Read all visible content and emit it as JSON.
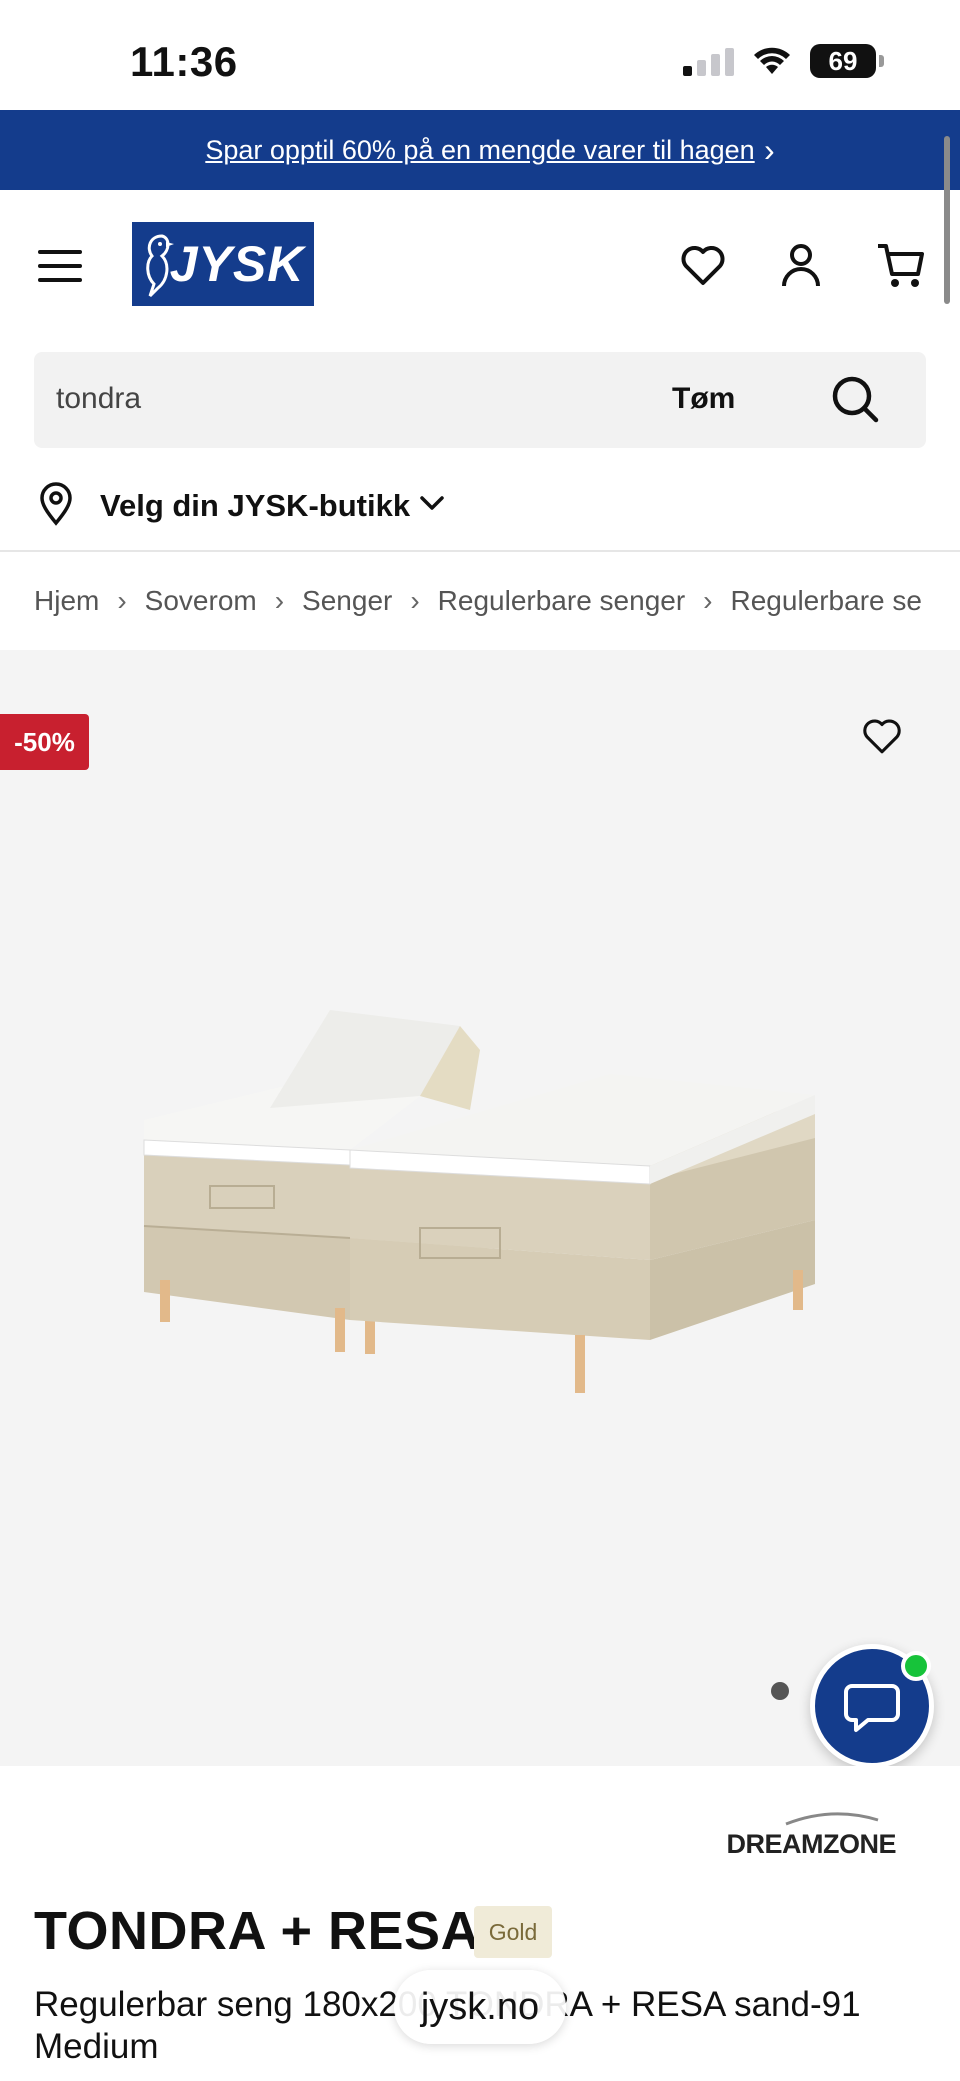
{
  "status_bar": {
    "time": "11:36",
    "battery": "69"
  },
  "promo": {
    "text": "Spar opptil 60% på en mengde varer til hagen",
    "chevron": "›"
  },
  "header": {
    "logo_text": "JYSK",
    "icons": [
      "menu-icon",
      "heart-icon",
      "user-icon",
      "cart-icon"
    ]
  },
  "search": {
    "value": "tondra",
    "clear_label": "Tøm"
  },
  "store": {
    "label": "Velg din JYSK-butikk"
  },
  "breadcrumb": {
    "items": [
      "Hjem",
      "Soverom",
      "Senger",
      "Regulerbare senger",
      "Regulerbare se"
    ],
    "separator": "›"
  },
  "gallery": {
    "discount": "-50%",
    "image_count": 1
  },
  "product": {
    "brand": "DREAMZONE",
    "title": "TONDRA + RESA",
    "tier": "Gold",
    "description": "Regulerbar seng 180x200 TONDRA + RESA sand-91 Medium"
  },
  "browser": {
    "url": "jysk.no"
  },
  "colors": {
    "brand_blue": "#143c8c",
    "discount_red": "#c8202f",
    "online_green": "#17c33a"
  }
}
